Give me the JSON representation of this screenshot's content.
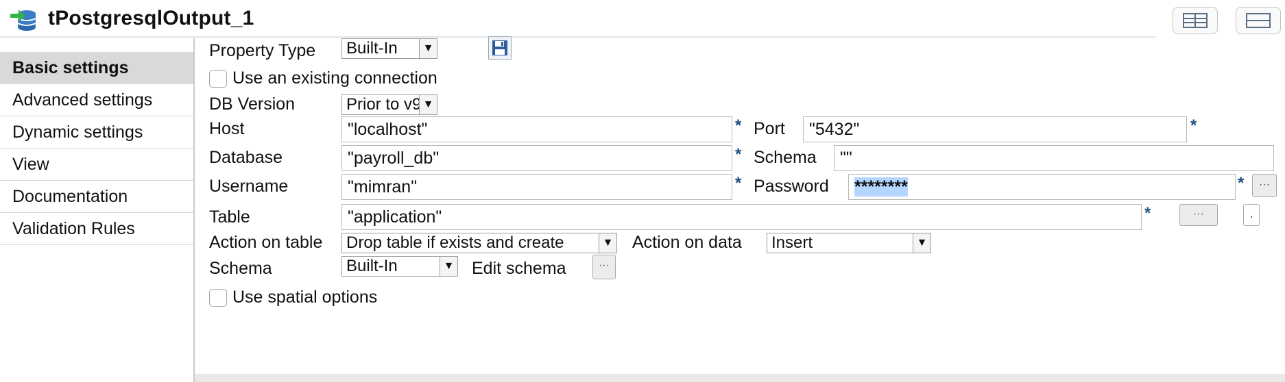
{
  "header": {
    "title": "tPostgresqlOutput_1",
    "app_icon": "postgresql-db-icon",
    "layout_buttons": [
      "split-view-icon",
      "single-view-icon"
    ]
  },
  "sidebar": {
    "items": [
      {
        "label": "Basic settings",
        "active": true
      },
      {
        "label": "Advanced settings"
      },
      {
        "label": "Dynamic settings"
      },
      {
        "label": "View"
      },
      {
        "label": "Documentation"
      },
      {
        "label": "Validation Rules"
      }
    ]
  },
  "form": {
    "property_type": {
      "label": "Property Type",
      "value": "Built-In",
      "save_icon": "floppy-disk-icon"
    },
    "use_existing_connection": {
      "label": "Use an existing connection",
      "checked": false
    },
    "db_version": {
      "label": "DB Version",
      "value": "Prior to v9"
    },
    "host": {
      "label": "Host",
      "value": "\"localhost\"",
      "required": "*"
    },
    "port": {
      "label": "Port",
      "value": "\"5432\"",
      "required": "*"
    },
    "database": {
      "label": "Database",
      "value": "\"payroll_db\"",
      "required": "*"
    },
    "schema": {
      "label": "Schema",
      "value": "\"\""
    },
    "username": {
      "label": "Username",
      "value": "\"mimran\"",
      "required": "*"
    },
    "password": {
      "label": "Password",
      "value": "********",
      "required": "*",
      "button": "···"
    },
    "table": {
      "label": "Table",
      "value": "\"application\"",
      "required": "*",
      "button": "···",
      "small_button": ","
    },
    "action_on_table": {
      "label": "Action on table",
      "value": "Drop table if exists and create"
    },
    "action_on_data": {
      "label": "Action on data",
      "value": "Insert"
    },
    "schema_type": {
      "label": "Schema",
      "value": "Built-In",
      "edit_label": "Edit schema",
      "button": "···"
    },
    "use_spatial_options": {
      "label": "Use spatial options",
      "checked": false
    }
  },
  "colors": {
    "required_star": "#1b4f80",
    "selection": "#b4d5fe",
    "sidebar_active": "#d9d9d9"
  }
}
